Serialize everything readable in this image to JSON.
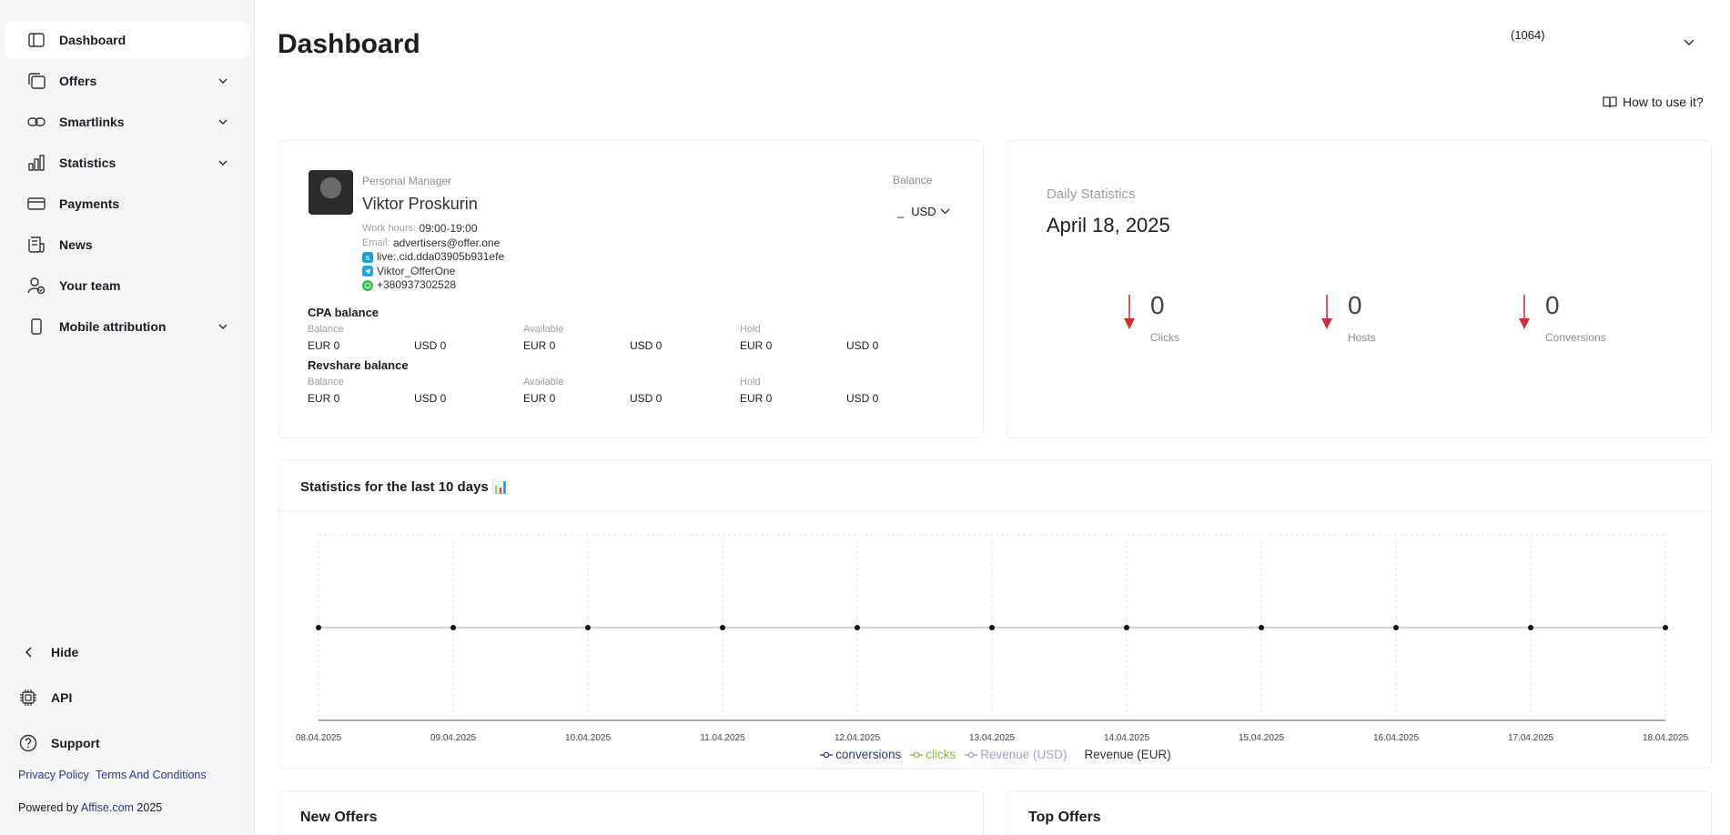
{
  "sidebar": {
    "items": [
      {
        "label": "Dashboard",
        "icon": "dashboard-icon"
      },
      {
        "label": "Offers",
        "icon": "offers-icon"
      },
      {
        "label": "Smartlinks",
        "icon": "link-icon"
      },
      {
        "label": "Statistics",
        "icon": "bar-chart-icon"
      },
      {
        "label": "Payments",
        "icon": "card-icon"
      },
      {
        "label": "News",
        "icon": "news-icon"
      },
      {
        "label": "Your team",
        "icon": "team-icon"
      },
      {
        "label": "Mobile attribution",
        "icon": "mobile-icon"
      }
    ],
    "hide_label": "Hide",
    "api_label": "API",
    "support_label": "Support",
    "privacy_label": "Privacy Policy",
    "terms_label": "Terms And Conditions",
    "powered_prefix": "Powered by",
    "powered_link": "Affise.com",
    "powered_year": "2025"
  },
  "header": {
    "title": "Dashboard",
    "user_id": "(1064)",
    "howto_label": "How to use it?"
  },
  "manager": {
    "label": "Personal Manager",
    "name": "Viktor Proskurin",
    "work_hours_label": "Work hours:",
    "work_hours": "09:00-19:00",
    "email_label": "Email:",
    "email": "advertisers@offer.one",
    "skype": "live:.cid.dda03905b931efe",
    "telegram": "Viktor_OfferOne",
    "whatsapp": "+380937302528",
    "balance_label": "Balance",
    "balance_dash": "_",
    "balance_currency": "USD"
  },
  "balances": {
    "cpa_title": "CPA balance",
    "revshare_title": "Revshare balance",
    "headers": [
      "Balance",
      "Available",
      "Hold"
    ],
    "cpa_values": [
      "EUR 0",
      "USD 0",
      "EUR 0",
      "USD 0",
      "EUR 0",
      "USD 0"
    ],
    "revshare_values": [
      "EUR 0",
      "USD 0",
      "EUR 0",
      "USD 0",
      "EUR 0",
      "USD 0"
    ]
  },
  "daily": {
    "label": "Daily Statistics",
    "date": "April 18, 2025",
    "metrics": [
      {
        "value": "0",
        "label": "Clicks"
      },
      {
        "value": "0",
        "label": "Hosts"
      },
      {
        "value": "0",
        "label": "Conversions"
      }
    ],
    "arrow_color": "#d0303a"
  },
  "chart_card": {
    "title": "Statistics for the last 10 days 📊"
  },
  "chart_data": {
    "type": "line",
    "x": [
      "08.04.2025",
      "09.04.2025",
      "10.04.2025",
      "11.04.2025",
      "12.04.2025",
      "13.04.2025",
      "14.04.2025",
      "15.04.2025",
      "16.04.2025",
      "17.04.2025",
      "18.04.2025"
    ],
    "series": [
      {
        "name": "conversions",
        "values": [
          0,
          0,
          0,
          0,
          0,
          0,
          0,
          0,
          0,
          0,
          0
        ],
        "color": "#2a3b8f"
      },
      {
        "name": "clicks",
        "values": [
          0,
          0,
          0,
          0,
          0,
          0,
          0,
          0,
          0,
          0,
          0
        ],
        "color": "#7cc142"
      },
      {
        "name": "Revenue (USD)",
        "values": [
          0,
          0,
          0,
          0,
          0,
          0,
          0,
          0,
          0,
          0,
          0
        ],
        "color": "#a89ad6"
      },
      {
        "name": "Revenue (EUR)",
        "values": [
          0,
          0,
          0,
          0,
          0,
          0,
          0,
          0,
          0,
          0,
          0
        ],
        "color": "#333333"
      }
    ],
    "grid": true,
    "legend": "bottom"
  },
  "new_offers": {
    "title": "New Offers"
  },
  "top_offers": {
    "title": "Top Offers"
  }
}
